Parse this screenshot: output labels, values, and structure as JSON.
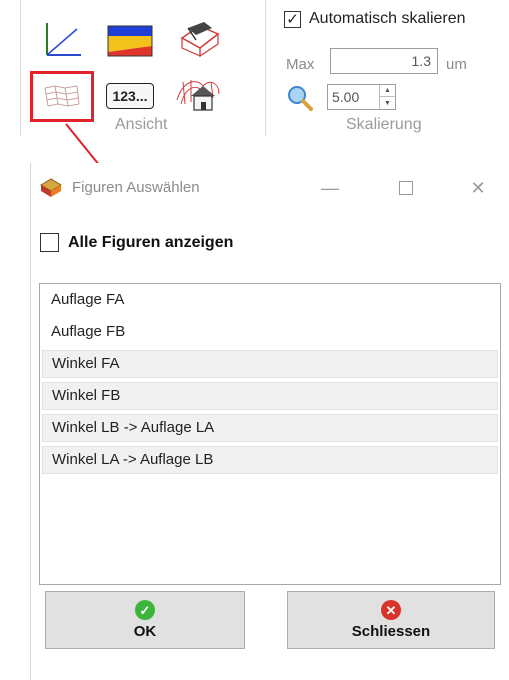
{
  "ribbon": {
    "groups": [
      {
        "label": "Ansicht"
      },
      {
        "label": "Skalierung"
      }
    ],
    "auto_scale": {
      "label": "Automatisch skalieren",
      "checked": true
    },
    "max": {
      "label": "Max",
      "value": "1.3",
      "unit": "um"
    },
    "zoom": {
      "value": "5.00"
    },
    "tools": [
      {
        "icon": "axes-icon"
      },
      {
        "icon": "color-bands-icon"
      },
      {
        "icon": "wireframe-object-icon"
      },
      {
        "icon": "grid-surface-icon"
      },
      {
        "icon": "numeric-display-icon",
        "text": "123..."
      },
      {
        "icon": "house-mesh-icon"
      }
    ]
  },
  "dialog": {
    "title": "Figuren Auswählen",
    "show_all": {
      "label": "Alle Figuren anzeigen",
      "checked": false
    },
    "items": [
      {
        "label": "Auflage FA"
      },
      {
        "label": "Auflage FB"
      },
      {
        "label": "Winkel FA"
      },
      {
        "label": "Winkel FB"
      },
      {
        "label": "Winkel LB -> Auflage LA"
      },
      {
        "label": "Winkel LA -> Auflage LB"
      }
    ],
    "ok_label": "OK",
    "close_label": "Schliessen"
  },
  "colors": {
    "highlight": "#e0232b",
    "ok_icon": "#3db53d",
    "close_icon": "#d9342b"
  }
}
